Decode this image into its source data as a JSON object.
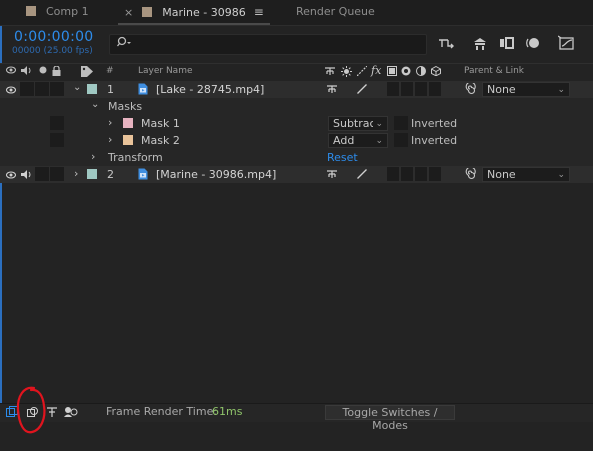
{
  "tabs": [
    {
      "label": "Comp 1",
      "color": "#a89580",
      "active": false
    },
    {
      "label": "Marine - 30986",
      "color": "#a89580",
      "active": true
    },
    {
      "label": "Render Queue",
      "active": false
    }
  ],
  "tab_close_glyph": "×",
  "tab_menu_glyph": "≡",
  "timecode": "0:00:00:00",
  "fps_label": "00000 (25.00 fps)",
  "search": {
    "value": "",
    "placeholder": ""
  },
  "toolbar_icons": [
    "shy-layers-icon",
    "draft-3d-icon",
    "frame-blending-icon",
    "motion-blur-icon",
    "graph-editor-icon"
  ],
  "columns": {
    "number": "#",
    "layer_name": "Layer Name",
    "parent_link": "Parent & Link"
  },
  "layers": [
    {
      "number": "1",
      "name": "[Lake - 28745.mp4]",
      "label_color": "#9fc8c2",
      "parent": "None",
      "expanded": true,
      "masks_label": "Masks",
      "masks": [
        {
          "name": "Mask 1",
          "color": "#e7b3c0",
          "mode": "Subtract",
          "inverted_label": "Inverted"
        },
        {
          "name": "Mask 2",
          "color": "#e9c39a",
          "mode": "Add",
          "inverted_label": "Inverted"
        }
      ],
      "transform_label": "Transform",
      "transform_reset": "Reset"
    },
    {
      "number": "2",
      "name": "[Marine - 30986.mp4]",
      "label_color": "#9fc8c2",
      "parent": "None",
      "expanded": false
    }
  ],
  "status": {
    "render_time_label": "Frame Render Time:",
    "render_time_value": "61ms",
    "toggle_label": "Toggle Switches / Modes"
  },
  "colors": {
    "accent": "#2d8ceb",
    "annotation": "#e0141e",
    "render_time": "#8fc46a"
  }
}
